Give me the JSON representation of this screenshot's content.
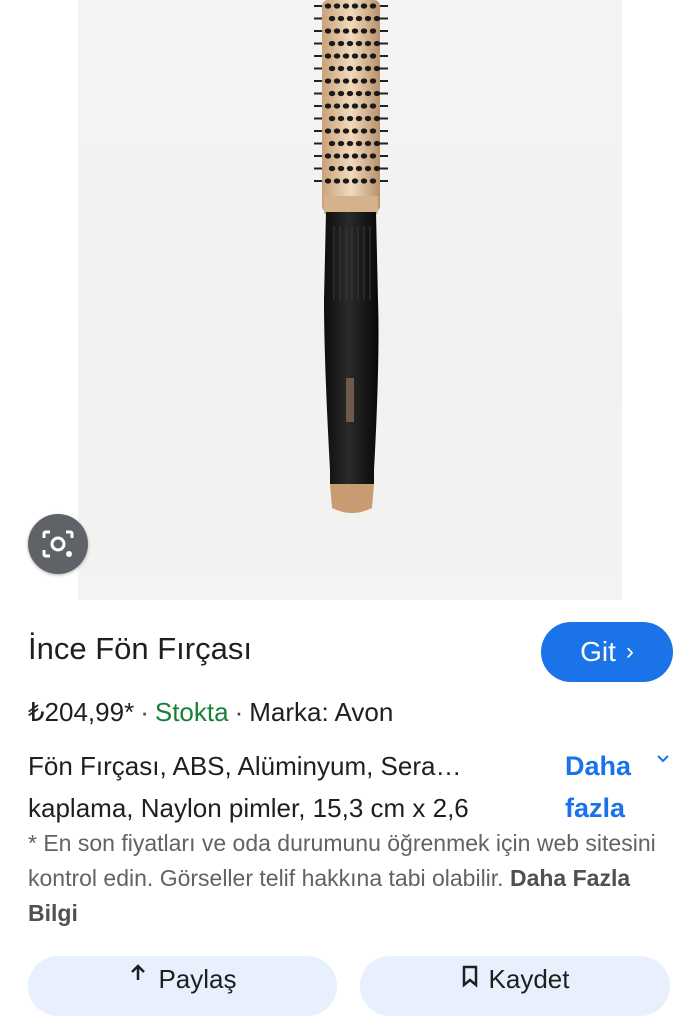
{
  "product": {
    "title": "İnce Fön Fırçası",
    "go_label": "Git",
    "go_chevron": "›",
    "price": "₺204,99*",
    "stock": "Stokta",
    "brand": "Marka: Avon",
    "desc_line1": "Fön Fırçası, ABS, Alüminyum, Sera…",
    "desc_line2": "kaplama, Naylon pimler, 15,3 cm x 2,6",
    "more_line1": "Daha",
    "more_line2": "fazla",
    "note_text": "* En son fiyatları ve oda durumunu öğrenmek için web sitesini kontrol edin. Görseller telif hakkına tabi olabilir. ",
    "note_link": "Daha Fazla Bilgi"
  },
  "separator": "·",
  "bottom": {
    "left_label": "Paylaş",
    "right_label": "Kaydet"
  },
  "colors": {
    "accent": "#1a73e8",
    "stock": "#188038",
    "lens_button": "#5f6368",
    "bottom_button_bg": "#e8f0fe"
  },
  "icons": {
    "lens": "camera-lens-icon",
    "share": "share-icon",
    "save": "bookmark-icon",
    "expand": "chevron-down-icon"
  }
}
